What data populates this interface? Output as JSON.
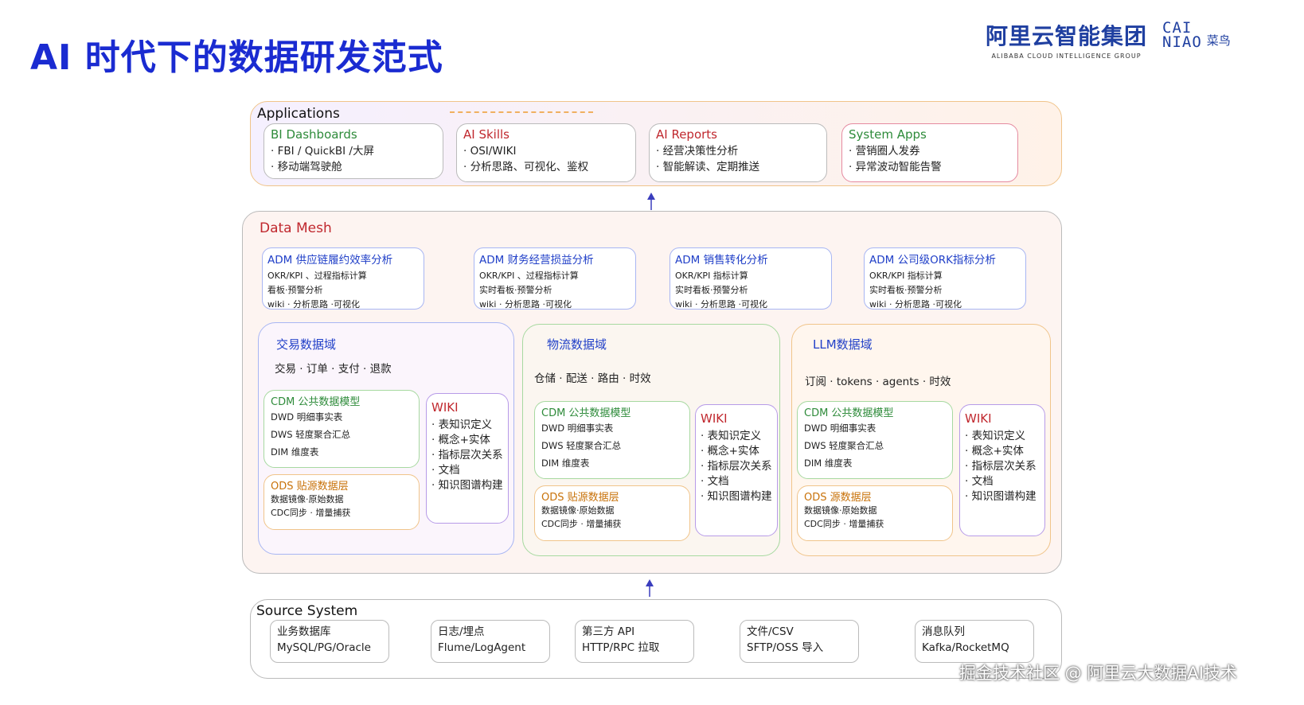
{
  "page": {
    "title": "AI 时代下的数据研发范式",
    "logo_alibaba_zh": "阿里云智能集团",
    "logo_alibaba_en": "ALIBABA CLOUD INTELLIGENCE GROUP",
    "logo_cainiao_mark_1": "CAI",
    "logo_cainiao_mark_2": "NIAO",
    "logo_cainiao_zh": "菜鸟",
    "watermark": "掘金技术社区 @ 阿里云大数据AI技术"
  },
  "applications": {
    "label": "Applications",
    "cards": [
      {
        "title": "BI Dashboards",
        "lines": [
          "· FBI / QuickBI /大屏",
          "· 移动端驾驶舱"
        ],
        "color": "#2e8b3a",
        "border": "#bbbbbb"
      },
      {
        "title": "AI Skills",
        "lines": [
          "· OSI/WIKI",
          "· 分析思路、可视化、鉴权"
        ],
        "color": "#c0282e",
        "border": "#bbbbbb"
      },
      {
        "title": "AI Reports",
        "lines": [
          "· 经营决策性分析",
          "· 智能解读、定期推送"
        ],
        "color": "#c0282e",
        "border": "#bbbbbb"
      },
      {
        "title": "System Apps",
        "lines": [
          "· 营销圈人发券",
          "· 异常波动智能告警"
        ],
        "color": "#2e8b3a",
        "border": "#e58aa0"
      }
    ]
  },
  "data_mesh": {
    "label": "Data Mesh",
    "adms": [
      {
        "title": "ADM 供应链履约效率分析",
        "lines": [
          "OKR/KPI 、过程指标计算",
          "看板·预警分析",
          "wiki · 分析思路 ·可视化"
        ]
      },
      {
        "title": "ADM 财务经营损益分析",
        "lines": [
          "OKR/KPI 、过程指标计算",
          "实时看板·预警分析",
          "wiki · 分析思路 ·可视化"
        ]
      },
      {
        "title": "ADM 销售转化分析",
        "lines": [
          "OKR/KPI 指标计算",
          "实时看板·预警分析",
          "wiki · 分析思路 ·可视化"
        ]
      },
      {
        "title": "ADM 公司级ORK指标分析",
        "lines": [
          "OKR/KPI 指标计算",
          "实时看板·预警分析",
          "wiki · 分析思路 ·可视化"
        ]
      }
    ],
    "domains": [
      {
        "name": "交易数据域",
        "sub": "交易 · 订单 · 支付 · 退款",
        "cdm_title": "CDM 公共数据模型",
        "cdm_lines": [
          "DWD 明细事实表",
          "DWS 轻度聚合汇总",
          "DIM 维度表"
        ],
        "ods_title": "ODS 贴源数据层",
        "ods_lines": [
          "数据镜像·原始数据",
          "CDC同步 · 增量捕获"
        ],
        "wiki_title": "WIKI",
        "wiki_lines": [
          "· 表知识定义",
          "· 概念+实体",
          "· 指标层次关系",
          "· 文档",
          "· 知识图谱构建"
        ],
        "border": "#a8b6f3"
      },
      {
        "name": "物流数据域",
        "sub": "仓储 · 配送 · 路由 · 时效",
        "cdm_title": "CDM 公共数据模型",
        "cdm_lines": [
          "DWD 明细事实表",
          "DWS 轻度聚合汇总",
          "DIM 维度表"
        ],
        "ods_title": "ODS 贴源数据层",
        "ods_lines": [
          "数据镜像·原始数据",
          "CDC同步 · 增量捕获"
        ],
        "wiki_title": "WIKI",
        "wiki_lines": [
          "· 表知识定义",
          "· 概念+实体",
          "· 指标层次关系",
          "· 文档",
          "· 知识图谱构建"
        ],
        "border": "#a7d9a0"
      },
      {
        "name": "LLM数据域",
        "sub": "订阅 · tokens · agents · 时效",
        "cdm_title": "CDM 公共数据模型",
        "cdm_lines": [
          "DWD 明细事实表",
          "DWS 轻度聚合汇总",
          "DIM 维度表"
        ],
        "ods_title": "ODS 源数据层",
        "ods_lines": [
          "数据镜像·原始数据",
          "CDC同步 · 增量捕获"
        ],
        "wiki_title": "WIKI",
        "wiki_lines": [
          "· 表知识定义",
          "· 概念+实体",
          "· 指标层次关系",
          "· 文档",
          "· 知识图谱构建"
        ],
        "border": "#f0c48a"
      }
    ]
  },
  "source_system": {
    "label": "Source System",
    "cards": [
      {
        "lines": [
          "业务数据库",
          "MySQL/PG/Oracle"
        ]
      },
      {
        "lines": [
          "日志/埋点",
          "Flume/LogAgent"
        ]
      },
      {
        "lines": [
          "第三方 API",
          "HTTP/RPC 拉取"
        ]
      },
      {
        "lines": [
          "文件/CSV",
          "SFTP/OSS 导入"
        ]
      },
      {
        "lines": [
          "消息队列",
          "Kafka/RocketMQ"
        ]
      }
    ]
  }
}
